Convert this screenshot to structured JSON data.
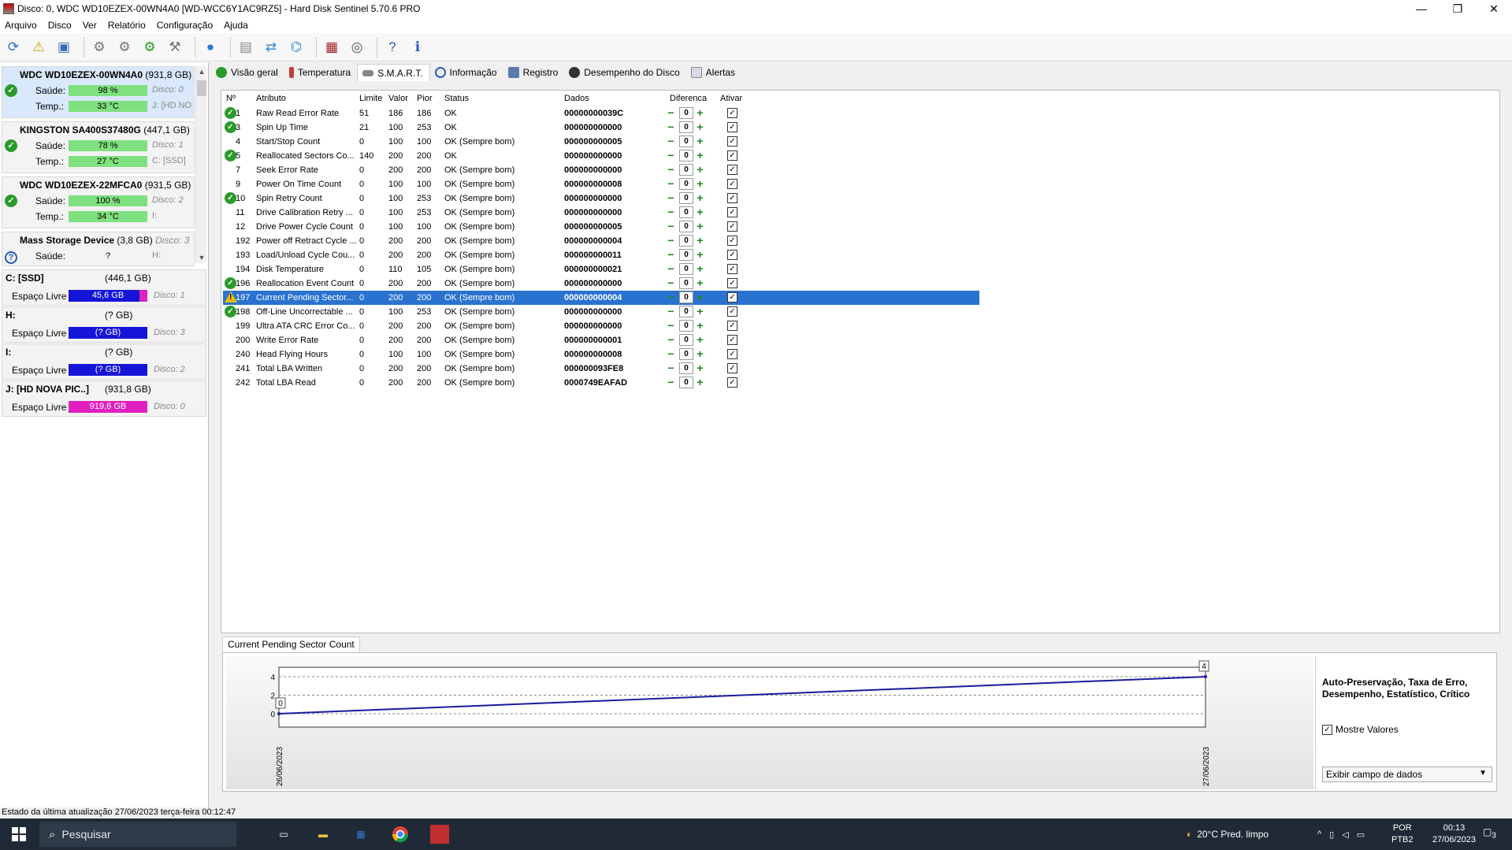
{
  "window": {
    "title": "Disco: 0, WDC WD10EZEX-00WN4A0 [WD-WCC6Y1AC9RZ5]  -  Hard Disk Sentinel 5.70.6 PRO",
    "controls": {
      "minimize": "—",
      "restore": "❐",
      "close": "✕"
    }
  },
  "menu": [
    "Arquivo",
    "Disco",
    "Ver",
    "Relatório",
    "Configuração",
    "Ajuda"
  ],
  "disks": [
    {
      "name": "WDC WD10EZEX-00WN4A0",
      "size": "(931,8 GB)",
      "health_label": "Saúde:",
      "health": "98 %",
      "health_pct": 98,
      "disk": "Disco: 0",
      "temp_label": "Temp.:",
      "temp": "33 °C",
      "drive": "J: [HD NO"
    },
    {
      "name": "KINGSTON SA400S37480G",
      "size": "(447,1 GB)",
      "health_label": "Saúde:",
      "health": "78 %",
      "health_pct": 78,
      "disk": "Disco: 1",
      "temp_label": "Temp.:",
      "temp": "27 °C",
      "drive": "C: [SSD]"
    },
    {
      "name": "WDC WD10EZEX-22MFCA0",
      "size": "(931,5 GB)",
      "health_label": "Saúde:",
      "health": "100 %",
      "health_pct": 100,
      "disk": "Disco: 2",
      "temp_label": "Temp.:",
      "temp": "34 °C",
      "drive": "I:"
    },
    {
      "name": "Mass   Storage Device",
      "size": "(3,8 GB)",
      "health_label": "Saúde:",
      "health": "?",
      "disk": "Disco: 3",
      "drive": "H:"
    }
  ],
  "partitions": [
    {
      "name": "C: [SSD]",
      "size": "(446,1 GB)",
      "label": "Espaço Livre",
      "free": "45,6 GB",
      "disk": "Disco: 1"
    },
    {
      "name": "H:",
      "size": "(? GB)",
      "label": "Espaço Livre",
      "free": "(? GB)",
      "disk": "Disco: 3"
    },
    {
      "name": "I:",
      "size": "(? GB)",
      "label": "Espaço Livre",
      "free": "(? GB)",
      "disk": "Disco: 2"
    },
    {
      "name": "J: [HD NOVA PIC..]",
      "size": "(931,8 GB)",
      "label": "Espaço Livre",
      "free": "919,6 GB",
      "disk": "Disco: 0"
    }
  ],
  "tabs": [
    "Visão geral",
    "Temperatura",
    "S.M.A.R.T.",
    "Informação",
    "Registro",
    "Desempenho do Disco",
    "Alertas"
  ],
  "smart": {
    "headers": {
      "num": "Nº",
      "attr": "Atributo",
      "limit": "Limite",
      "value": "Valor",
      "worst": "Pior",
      "status": "Status",
      "data": "Dados",
      "diff": "Diferenca",
      "enable": "Ativar"
    },
    "rows": [
      {
        "num": "1",
        "attr": "Raw Read Error Rate",
        "limit": "51",
        "value": "186",
        "worst": "186",
        "status": "OK",
        "data": "00000000039C",
        "icon": "ok"
      },
      {
        "num": "3",
        "attr": "Spin Up Time",
        "limit": "21",
        "value": "100",
        "worst": "253",
        "status": "OK",
        "data": "000000000000",
        "icon": "ok"
      },
      {
        "num": "4",
        "attr": "Start/Stop Count",
        "limit": "0",
        "value": "100",
        "worst": "100",
        "status": "OK (Sempre bom)",
        "data": "000000000005",
        "icon": ""
      },
      {
        "num": "5",
        "attr": "Reallocated Sectors Co...",
        "limit": "140",
        "value": "200",
        "worst": "200",
        "status": "OK",
        "data": "000000000000",
        "icon": "ok"
      },
      {
        "num": "7",
        "attr": "Seek Error Rate",
        "limit": "0",
        "value": "200",
        "worst": "200",
        "status": "OK (Sempre bom)",
        "data": "000000000000",
        "icon": ""
      },
      {
        "num": "9",
        "attr": "Power On Time Count",
        "limit": "0",
        "value": "100",
        "worst": "100",
        "status": "OK (Sempre bom)",
        "data": "000000000008",
        "icon": ""
      },
      {
        "num": "10",
        "attr": "Spin Retry Count",
        "limit": "0",
        "value": "100",
        "worst": "253",
        "status": "OK (Sempre bom)",
        "data": "000000000000",
        "icon": "ok"
      },
      {
        "num": "11",
        "attr": "Drive Calibration Retry ...",
        "limit": "0",
        "value": "100",
        "worst": "253",
        "status": "OK (Sempre bom)",
        "data": "000000000000",
        "icon": ""
      },
      {
        "num": "12",
        "attr": "Drive Power Cycle Count",
        "limit": "0",
        "value": "100",
        "worst": "100",
        "status": "OK (Sempre bom)",
        "data": "000000000005",
        "icon": ""
      },
      {
        "num": "192",
        "attr": "Power off Retract Cycle ...",
        "limit": "0",
        "value": "200",
        "worst": "200",
        "status": "OK (Sempre bom)",
        "data": "000000000004",
        "icon": ""
      },
      {
        "num": "193",
        "attr": "Load/Unload Cycle Cou...",
        "limit": "0",
        "value": "200",
        "worst": "200",
        "status": "OK (Sempre bom)",
        "data": "000000000011",
        "icon": ""
      },
      {
        "num": "194",
        "attr": "Disk Temperature",
        "limit": "0",
        "value": "110",
        "worst": "105",
        "status": "OK (Sempre bom)",
        "data": "000000000021",
        "icon": ""
      },
      {
        "num": "196",
        "attr": "Reallocation Event Count",
        "limit": "0",
        "value": "200",
        "worst": "200",
        "status": "OK (Sempre bom)",
        "data": "000000000000",
        "icon": "ok"
      },
      {
        "num": "197",
        "attr": "Current Pending Sector...",
        "limit": "0",
        "value": "200",
        "worst": "200",
        "status": "OK (Sempre bom)",
        "data": "000000000004",
        "icon": "warn",
        "selected": true
      },
      {
        "num": "198",
        "attr": "Off-Line Uncorrectable ...",
        "limit": "0",
        "value": "100",
        "worst": "253",
        "status": "OK (Sempre bom)",
        "data": "000000000000",
        "icon": "ok"
      },
      {
        "num": "199",
        "attr": "Ultra ATA CRC Error Co...",
        "limit": "0",
        "value": "200",
        "worst": "200",
        "status": "OK (Sempre bom)",
        "data": "000000000000",
        "icon": ""
      },
      {
        "num": "200",
        "attr": "Write Error Rate",
        "limit": "0",
        "value": "200",
        "worst": "200",
        "status": "OK (Sempre bom)",
        "data": "000000000001",
        "icon": ""
      },
      {
        "num": "240",
        "attr": "Head Flying Hours",
        "limit": "0",
        "value": "100",
        "worst": "100",
        "status": "OK (Sempre bom)",
        "data": "000000000008",
        "icon": ""
      },
      {
        "num": "241",
        "attr": "Total LBA Written",
        "limit": "0",
        "value": "200",
        "worst": "200",
        "status": "OK (Sempre bom)",
        "data": "000000093FE8",
        "icon": ""
      },
      {
        "num": "242",
        "attr": "Total LBA Read",
        "limit": "0",
        "value": "200",
        "worst": "200",
        "status": "OK (Sempre bom)",
        "data": "0000749EAFAD",
        "icon": ""
      }
    ],
    "diff_value": "0"
  },
  "graph": {
    "tab_label": "Current Pending Sector Count",
    "side_title": "Auto-Preservação, Taxa de Erro, Desempenho, Estatístico, Crítico",
    "show_values_label": "Mostre Valores",
    "select_value": "Exibir campo de dados"
  },
  "chart_data": {
    "type": "line",
    "x": [
      "26/06/2023",
      "27/06/2023"
    ],
    "series": [
      {
        "values": [
          0,
          4
        ]
      }
    ],
    "yticks": [
      "0",
      "2",
      "4"
    ],
    "ylim": [
      0,
      4
    ],
    "data_labels": [
      "0",
      "4"
    ],
    "grid": true
  },
  "statusbar": {
    "text": "Estado da última atualização 27/06/2023 terça-feira 00:12:47"
  },
  "taskbar": {
    "search": "Pesquisar",
    "weather": "20°C  Pred. limpo",
    "lang": "POR",
    "layout": "PTB2",
    "time": "00:13",
    "date": "27/06/2023",
    "notif_count": "3"
  },
  "colors": {
    "health_green": "#7ee07e",
    "free_blue": "#1515d8",
    "free_magenta": "#e020c0",
    "selection": "#2a72d0",
    "graph_line": "#1a1aa0"
  }
}
